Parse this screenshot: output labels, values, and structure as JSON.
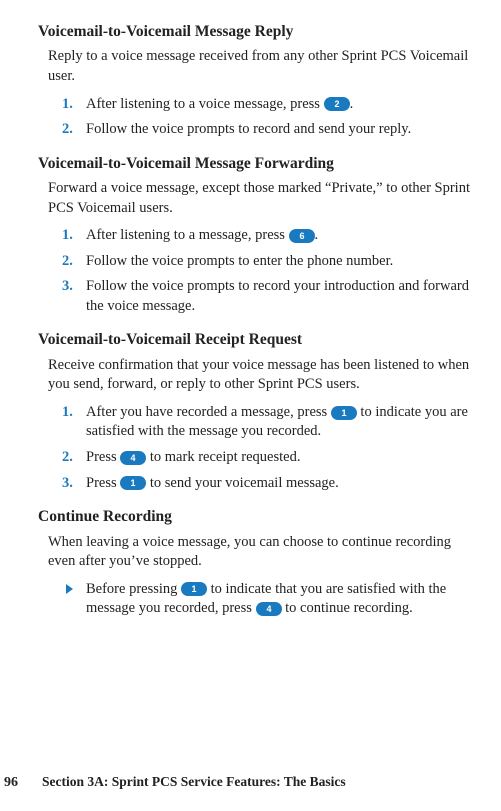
{
  "sections": {
    "reply": {
      "heading": "Voicemail-to-Voicemail Message Reply",
      "intro": "Reply to a voice message received from any other Sprint PCS Voicemail user.",
      "steps": {
        "s1": {
          "num": "1.",
          "a": "After listening to a voice message, press ",
          "key": "2",
          "b": "."
        },
        "s2": {
          "num": "2.",
          "text": "Follow the voice prompts to record and send your reply."
        }
      }
    },
    "forward": {
      "heading": "Voicemail-to-Voicemail Message Forwarding",
      "intro": "Forward a voice message, except those marked “Private,” to other Sprint PCS Voicemail users.",
      "steps": {
        "s1": {
          "num": "1.",
          "a": "After listening to a message, press ",
          "key": "6",
          "b": "."
        },
        "s2": {
          "num": "2.",
          "text": "Follow the voice prompts to enter the phone number."
        },
        "s3": {
          "num": "3.",
          "text": "Follow the voice prompts to record your introduction and forward the voice message."
        }
      }
    },
    "receipt": {
      "heading": "Voicemail-to-Voicemail Receipt Request",
      "intro": "Receive confirmation that your voice message has been listened to when you send, forward, or reply to other Sprint PCS users.",
      "steps": {
        "s1": {
          "num": "1.",
          "a": "After you have recorded a message, press ",
          "key": "1",
          "b": " to indicate you are satisfied with the message you recorded."
        },
        "s2": {
          "num": "2.",
          "a": "Press ",
          "key": "4",
          "b": " to mark receipt requested."
        },
        "s3": {
          "num": "3.",
          "a": "Press ",
          "key": "1",
          "b": " to send your voicemail message."
        }
      }
    },
    "continue": {
      "heading": "Continue Recording",
      "intro": "When leaving a voice message, you can choose to continue recording even after you’ve stopped.",
      "bullet": {
        "a": "Before pressing ",
        "key1": "1",
        "mid": " to indicate that you are satisfied with the message you recorded, press ",
        "key2": "4",
        "b": " to continue recording."
      }
    }
  },
  "footer": {
    "page": "96",
    "label": "Section 3A: Sprint PCS Service Features: The Basics"
  },
  "colors": {
    "accent": "#1a7abf"
  }
}
